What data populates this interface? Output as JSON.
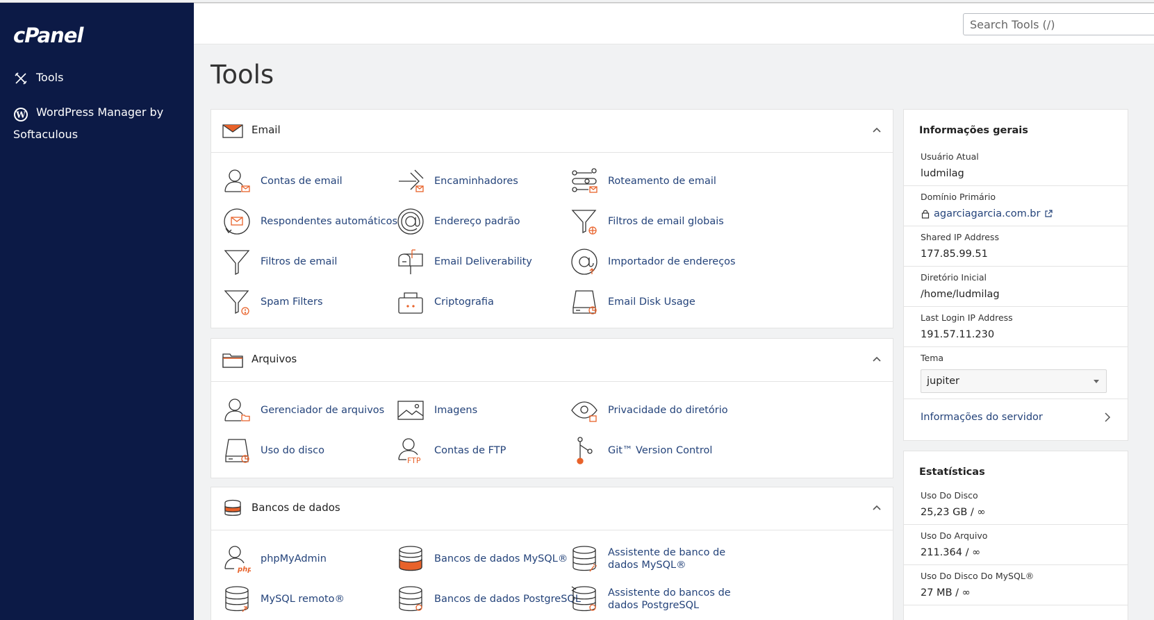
{
  "sidebar": {
    "logo": "cPanel",
    "items": [
      {
        "label": "Tools",
        "icon": "tools-icon"
      },
      {
        "label": "WordPress Manager by Softaculous",
        "icon": "wordpress-icon"
      }
    ]
  },
  "header": {
    "search_placeholder": "Search Tools (/)"
  },
  "page": {
    "title": "Tools"
  },
  "sections": {
    "email": {
      "title": "Email",
      "tools": [
        {
          "label": "Contas de email",
          "icon": "email-accounts-icon"
        },
        {
          "label": "Encaminhadores",
          "icon": "forwarders-icon"
        },
        {
          "label": "Roteamento de email",
          "icon": "email-routing-icon"
        },
        {
          "label": "Respondentes automáticos",
          "icon": "autoresponders-icon"
        },
        {
          "label": "Endereço padrão",
          "icon": "default-address-icon"
        },
        {
          "label": "Filtros de email globais",
          "icon": "global-email-filters-icon"
        },
        {
          "label": "Filtros de email",
          "icon": "email-filters-icon"
        },
        {
          "label": "Email Deliverability",
          "icon": "email-deliverability-icon"
        },
        {
          "label": "Importador de endereços",
          "icon": "address-importer-icon"
        },
        {
          "label": "Spam Filters",
          "icon": "spam-filters-icon"
        },
        {
          "label": "Criptografia",
          "icon": "encryption-icon"
        },
        {
          "label": "Email Disk Usage",
          "icon": "email-disk-usage-icon"
        }
      ]
    },
    "files": {
      "title": "Arquivos",
      "tools": [
        {
          "label": "Gerenciador de arquivos",
          "icon": "file-manager-icon"
        },
        {
          "label": "Imagens",
          "icon": "images-icon"
        },
        {
          "label": "Privacidade do diretório",
          "icon": "directory-privacy-icon"
        },
        {
          "label": "Uso do disco",
          "icon": "disk-usage-icon"
        },
        {
          "label": "Contas de FTP",
          "icon": "ftp-accounts-icon"
        },
        {
          "label": "Git™ Version Control",
          "icon": "git-icon"
        }
      ]
    },
    "databases": {
      "title": "Bancos de dados",
      "tools": [
        {
          "label": "phpMyAdmin",
          "icon": "phpmyadmin-icon"
        },
        {
          "label": "Bancos de dados MySQL®",
          "icon": "mysql-databases-icon"
        },
        {
          "label1": "Assistente de banco de",
          "label2": "dados MySQL®",
          "icon": "mysql-wizard-icon"
        },
        {
          "label": "MySQL remoto®",
          "icon": "remote-mysql-icon"
        },
        {
          "label": "Bancos de dados PostgreSQL",
          "icon": "postgresql-databases-icon"
        },
        {
          "label1": "Assistente do bancos de",
          "label2": "dados PostgreSQL",
          "icon": "postgresql-wizard-icon"
        }
      ]
    }
  },
  "general_info": {
    "title": "Informações gerais",
    "rows": [
      {
        "label": "Usuário Atual",
        "value": "ludmilag"
      },
      {
        "label": "Domínio Primário",
        "value": "agarciagarcia.com.br"
      },
      {
        "label": "Shared IP Address",
        "value": "177.85.99.51"
      },
      {
        "label": "Diretório Inicial",
        "value": "/home/ludmilag"
      },
      {
        "label": "Last Login IP Address",
        "value": "191.57.11.230"
      }
    ],
    "theme_label": "Tema",
    "theme_value": "jupiter",
    "server_info_link": "Informações do servidor"
  },
  "stats": {
    "title": "Estatísticas",
    "rows": [
      {
        "label": "Uso Do Disco",
        "value": "25,23 GB / ∞"
      },
      {
        "label": "Uso Do Arquivo",
        "value": "211.364 / ∞"
      },
      {
        "label": "Uso Do Disco Do MySQL®",
        "value": "27 MB / ∞"
      }
    ]
  },
  "colors": {
    "sidebar_bg": "#0c1a46",
    "accent": "#e8622a",
    "link": "#24437a"
  }
}
